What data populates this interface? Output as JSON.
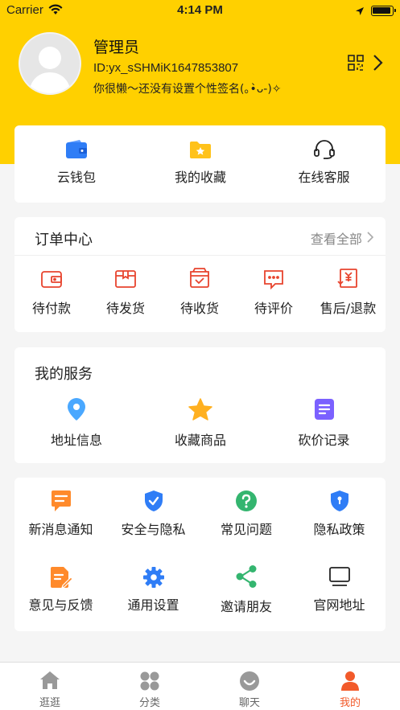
{
  "status_bar": {
    "carrier": "Carrier",
    "time": "4:14 PM"
  },
  "profile": {
    "name": "管理员",
    "id": "ID:yx_sSHMiK1647853807",
    "signature": "你很懒～还没有设置个性签名(｡•̀ᴗ-)✧"
  },
  "quick_actions": [
    {
      "label": "云钱包",
      "icon": "wallet-icon"
    },
    {
      "label": "我的收藏",
      "icon": "folder-star-icon"
    },
    {
      "label": "在线客服",
      "icon": "headset-icon"
    }
  ],
  "orders": {
    "title": "订单中心",
    "view_all": "查看全部",
    "items": [
      {
        "label": "待付款",
        "icon": "wallet-pay-icon"
      },
      {
        "label": "待发货",
        "icon": "box-icon"
      },
      {
        "label": "待收货",
        "icon": "bag-check-icon"
      },
      {
        "label": "待评价",
        "icon": "chat-bubble-icon"
      },
      {
        "label": "售后/退款",
        "icon": "refund-icon"
      }
    ]
  },
  "services": {
    "title": "我的服务",
    "items": [
      {
        "label": "地址信息",
        "icon": "location-pin-icon"
      },
      {
        "label": "收藏商品",
        "icon": "star-icon"
      },
      {
        "label": "砍价记录",
        "icon": "document-icon"
      }
    ]
  },
  "settings": {
    "items": [
      {
        "label": "新消息通知",
        "icon": "message-icon"
      },
      {
        "label": "安全与隐私",
        "icon": "shield-check-icon"
      },
      {
        "label": "常见问题",
        "icon": "question-icon"
      },
      {
        "label": "隐私政策",
        "icon": "shield-lock-icon"
      },
      {
        "label": "意见与反馈",
        "icon": "feedback-icon"
      },
      {
        "label": "通用设置",
        "icon": "gear-icon"
      },
      {
        "label": "邀请朋友",
        "icon": "share-icon"
      },
      {
        "label": "官网地址",
        "icon": "monitor-icon"
      }
    ]
  },
  "tabbar": {
    "active": "我的",
    "items": [
      {
        "label": "逛逛",
        "icon": "home-icon"
      },
      {
        "label": "分类",
        "icon": "category-icon"
      },
      {
        "label": "聊天",
        "icon": "chat-face-icon"
      },
      {
        "label": "我的",
        "icon": "person-icon"
      }
    ]
  },
  "colors": {
    "brand_yellow": "#ffd000",
    "order_red": "#e8442e",
    "active_tab": "#f25a2a",
    "blue": "#2f7df6",
    "green": "#34b56f"
  }
}
